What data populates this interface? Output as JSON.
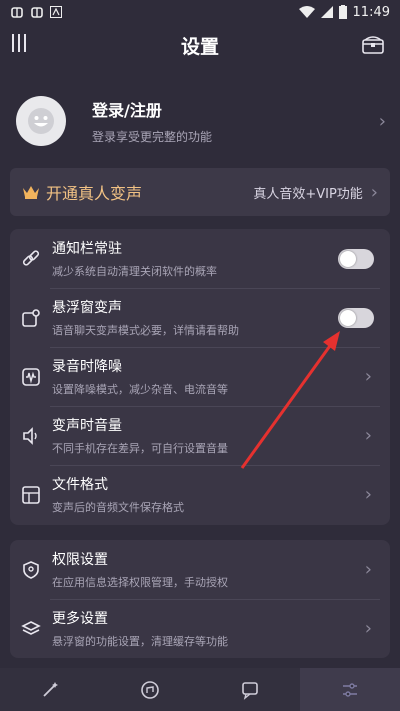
{
  "status_bar": {
    "left_icons": [
      "bug-icon",
      "bug-icon",
      "notification-a-icon"
    ],
    "time": "11:49"
  },
  "header": {
    "title": "设置"
  },
  "profile": {
    "name": "登录/注册",
    "subtitle": "登录享受更完整的功能"
  },
  "vip": {
    "title": "开通真人变声",
    "right_text": "真人音效+VIP功能"
  },
  "settings": [
    {
      "title": "通知栏常驻",
      "subtitle": "减少系统自动清理关闭软件的概率",
      "control": "toggle",
      "on": false,
      "icon": "link-icon"
    },
    {
      "title": "悬浮窗变声",
      "subtitle": "语音聊天变声模式必要，详情请看帮助",
      "control": "toggle",
      "on": false,
      "icon": "floating-window-icon"
    },
    {
      "title": "录音时降噪",
      "subtitle": "设置降噪模式，减少杂音、电流音等",
      "control": "chevron",
      "icon": "noise-reduction-icon"
    },
    {
      "title": "变声时音量",
      "subtitle": "不同手机存在差异，可自行设置音量",
      "control": "chevron",
      "icon": "speaker-icon"
    },
    {
      "title": "文件格式",
      "subtitle": "变声后的音频文件保存格式",
      "control": "chevron",
      "icon": "file-format-icon"
    }
  ],
  "more": [
    {
      "title": "权限设置",
      "subtitle": "在应用信息选择权限管理，手动授权",
      "icon": "shield-icon"
    },
    {
      "title": "更多设置",
      "subtitle": "悬浮窗的功能设置，清理缓存等功能",
      "icon": "layers-icon"
    }
  ],
  "bottom_tabs": [
    {
      "icon": "magic-wand-icon",
      "active": false
    },
    {
      "icon": "voice-pack-icon",
      "active": false
    },
    {
      "icon": "chat-icon",
      "active": false
    },
    {
      "icon": "settings-sliders-icon",
      "active": true
    }
  ],
  "colors": {
    "background": "#2f2c3a",
    "card": "#3a3645",
    "vip_text": "#f2c284",
    "arrow": "#e5312f"
  }
}
